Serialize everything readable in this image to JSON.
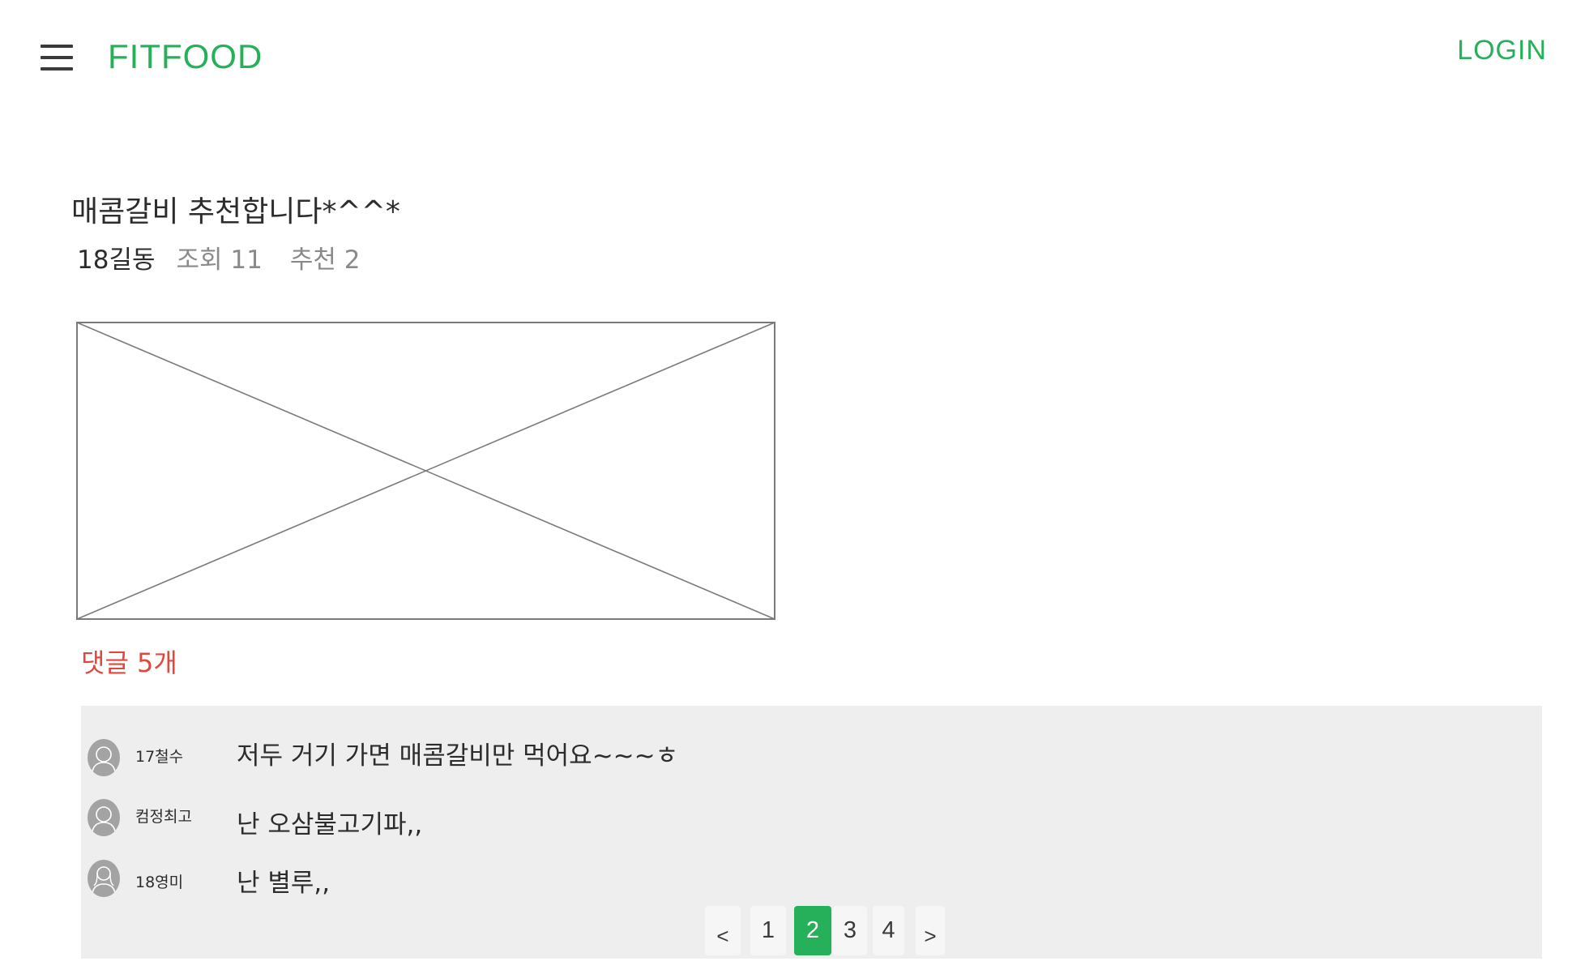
{
  "colors": {
    "accent": "#27b05a",
    "comment_count": "#e0483e",
    "panel_bg": "#eeeeee"
  },
  "header": {
    "menu_icon": "hamburger-menu-icon",
    "brand": "FITFOOD",
    "login": "LOGIN"
  },
  "post": {
    "title": "매콤갈비 추천합니다*^^*",
    "author": "18길동",
    "views": "조회 11",
    "likes": "추천 2",
    "image": "image-placeholder"
  },
  "comments": {
    "count_label": "댓글 5개",
    "items": [
      {
        "avatar": "user-avatar-icon",
        "username": "17철수",
        "text": "저두 거기 가면 매콤갈비만 먹어요~~~ㅎ"
      },
      {
        "avatar": "user-avatar-icon",
        "username": "컴정최고",
        "text": "난 오삼불고기파,,"
      },
      {
        "avatar": "user-avatar-icon",
        "username": "18영미",
        "text": "난 별루,,"
      }
    ]
  },
  "pagination": {
    "prev": "<",
    "pages": [
      "1",
      "2",
      "3",
      "4"
    ],
    "current": "2",
    "next": ">"
  }
}
